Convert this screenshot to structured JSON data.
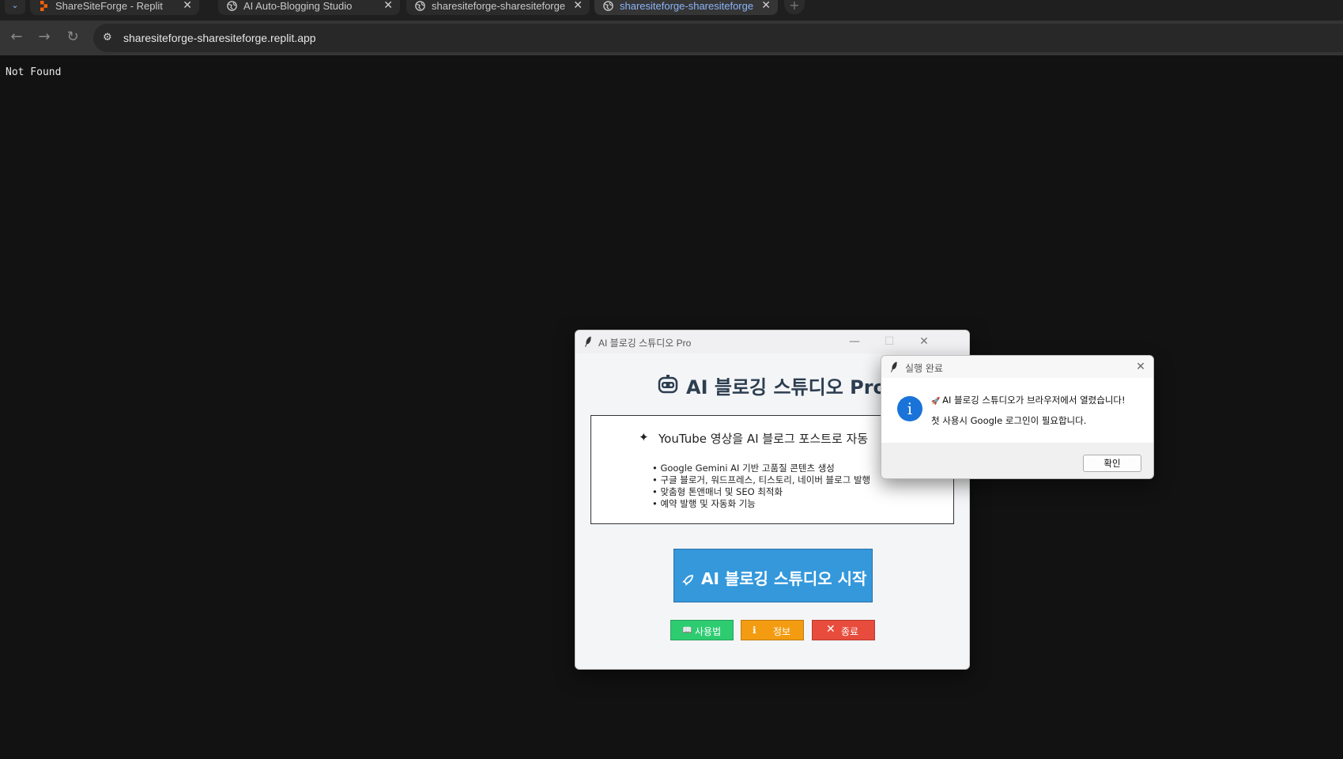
{
  "browser": {
    "tabs": [
      {
        "title": "ShareSiteForge - Replit",
        "icon": "replit-icon",
        "active": false
      },
      {
        "title": "AI Auto-Blogging Studio",
        "icon": "globe-icon",
        "active": false
      },
      {
        "title": "sharesiteforge-sharesiteforge.r",
        "icon": "globe-icon",
        "active": false
      },
      {
        "title": "sharesiteforge-sharesiteforge.r",
        "icon": "globe-icon",
        "active": true
      }
    ],
    "url": "sharesiteforge-sharesiteforge.replit.app"
  },
  "page": {
    "body_text": "Not Found"
  },
  "app_window": {
    "title": "AI 블로깅 스튜디오 Pro",
    "heading": "AI 블로깅 스튜디오 Pro",
    "feature_title": "YouTube 영상을 AI 블로그 포스트로 자동",
    "features": [
      "Google Gemini AI 기반 고품질 콘텐츠 생성",
      "구글 블로거, 워드프레스, 티스토리, 네이버 블로그 발행",
      "맞춤형 톤앤매너 및 SEO 최적화",
      "예약 발행 및 자동화 기능"
    ],
    "start_button": "AI 블로깅 스튜디오 시작",
    "buttons": {
      "usage": "사용법",
      "info": "정보",
      "exit": "종료"
    },
    "colors": {
      "start": "#3498db",
      "usage": "#2ecc71",
      "info": "#f39c12",
      "exit": "#e74c3c"
    }
  },
  "dialog": {
    "title": "실행 완료",
    "line1": "AI 블로깅 스튜디오가 브라우저에서 열렸습니다!",
    "line2": "첫 사용시 Google 로그인이 필요합니다.",
    "ok": "확인",
    "icon": "info-icon"
  }
}
